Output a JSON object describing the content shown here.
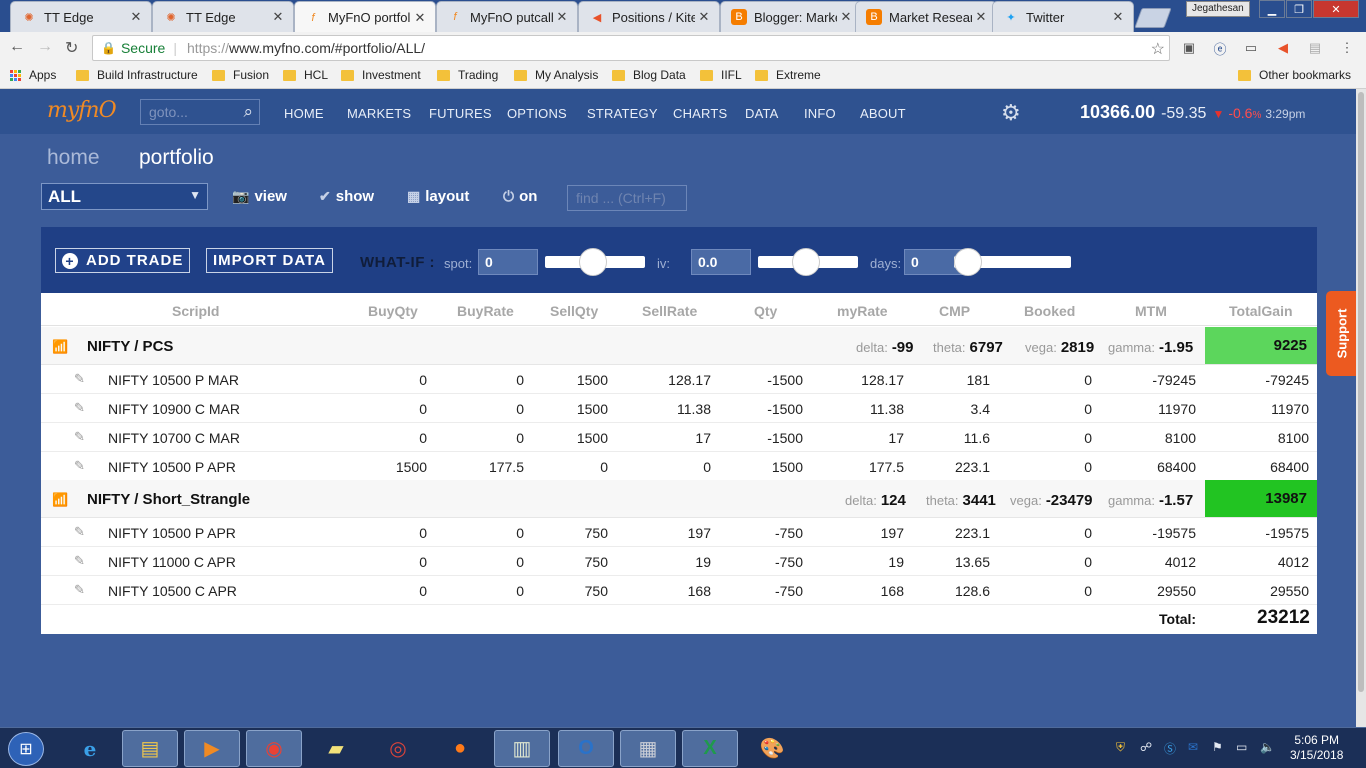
{
  "browser": {
    "tabs": [
      {
        "title": "TT Edge",
        "active": false
      },
      {
        "title": "TT Edge",
        "active": false
      },
      {
        "title": "MyFnO portfoli",
        "active": true
      },
      {
        "title": "MyFnO putcall",
        "active": false
      },
      {
        "title": "Positions / Kite",
        "active": false
      },
      {
        "title": "Blogger: Marke",
        "active": false
      },
      {
        "title": "Market Researc",
        "active": false
      },
      {
        "title": "Twitter",
        "active": false
      }
    ],
    "close_glyph": "✕",
    "user": "Jegathesan",
    "secure_label": "Secure",
    "url_scheme": "https://",
    "url_rest": "www.myfno.com/#portfolio/ALL/",
    "bookmarks": [
      "Apps",
      "Build Infrastructure",
      "Fusion",
      "HCL",
      "Investment",
      "Trading",
      "My Analysis",
      "Blog Data",
      "IIFL",
      "Extreme"
    ],
    "other_bookmarks": "Other bookmarks"
  },
  "site": {
    "logo": "myfnO",
    "goto_placeholder": "goto...",
    "menu": [
      "HOME",
      "MARKETS",
      "FUTURES",
      "OPTIONS",
      "STRATEGY",
      "CHARTS",
      "DATA",
      "INFO",
      "ABOUT"
    ],
    "ticker": {
      "value": "10366.00",
      "change": "-59.35",
      "pct": "-0.6",
      "pct_sign": "%",
      "time": "3:29pm",
      "down_color": "#e8312c"
    }
  },
  "breadcrumb": {
    "home": "home",
    "current": "portfolio"
  },
  "controls": {
    "select_value": "ALL",
    "view": "view",
    "show": "show",
    "layout": "layout",
    "on": "on",
    "find_placeholder": "find ... (Ctrl+F)"
  },
  "whatif": {
    "add_trade": "ADD TRADE",
    "import_data": "IMPORT DATA",
    "label": "WHAT-IF :",
    "spot_label": "spot:",
    "spot_value": "0",
    "iv_label": "iv:",
    "iv_value": "0.0",
    "days_label": "days:",
    "days_value": "0"
  },
  "table": {
    "headers": [
      "ScripId",
      "BuyQty",
      "BuyRate",
      "SellQty",
      "SellRate",
      "Qty",
      "myRate",
      "CMP",
      "Booked",
      "MTM",
      "TotalGain"
    ],
    "groups": [
      {
        "name": "NIFTY / PCS",
        "delta_label": "delta:",
        "delta": "-99",
        "theta_label": "theta:",
        "theta": "6797",
        "vega_label": "vega:",
        "vega": "2819",
        "gamma_label": "gamma:",
        "gamma": "-1.95",
        "total": "9225",
        "total_color": "#5cd65c",
        "rows": [
          [
            "NIFTY 10500 P MAR",
            "0",
            "0",
            "1500",
            "128.17",
            "-1500",
            "128.17",
            "181",
            "0",
            "-79245",
            "-79245"
          ],
          [
            "NIFTY 10900 C MAR",
            "0",
            "0",
            "1500",
            "11.38",
            "-1500",
            "11.38",
            "3.4",
            "0",
            "11970",
            "11970"
          ],
          [
            "NIFTY 10700 C MAR",
            "0",
            "0",
            "1500",
            "17",
            "-1500",
            "17",
            "11.6",
            "0",
            "8100",
            "8100"
          ],
          [
            "NIFTY 10500 P APR",
            "1500",
            "177.5",
            "0",
            "0",
            "1500",
            "177.5",
            "223.1",
            "0",
            "68400",
            "68400"
          ]
        ]
      },
      {
        "name": "NIFTY / Short_Strangle",
        "delta_label": "delta:",
        "delta": "124",
        "theta_label": "theta:",
        "theta": "3441",
        "vega_label": "vega:",
        "vega": "-23479",
        "gamma_label": "gamma:",
        "gamma": "-1.57",
        "total": "13987",
        "total_color": "#22c422",
        "rows": [
          [
            "NIFTY 10500 P APR",
            "0",
            "0",
            "750",
            "197",
            "-750",
            "197",
            "223.1",
            "0",
            "-19575",
            "-19575"
          ],
          [
            "NIFTY 11000 C APR",
            "0",
            "0",
            "750",
            "19",
            "-750",
            "19",
            "13.65",
            "0",
            "4012",
            "4012"
          ],
          [
            "NIFTY 10500 C APR",
            "0",
            "0",
            "750",
            "168",
            "-750",
            "168",
            "128.6",
            "0",
            "29550",
            "29550"
          ]
        ]
      }
    ],
    "total_label": "Total:",
    "total_value": "23212"
  },
  "support": "Support",
  "taskbar": {
    "time": "5:06 PM",
    "date": "3/15/2018"
  }
}
